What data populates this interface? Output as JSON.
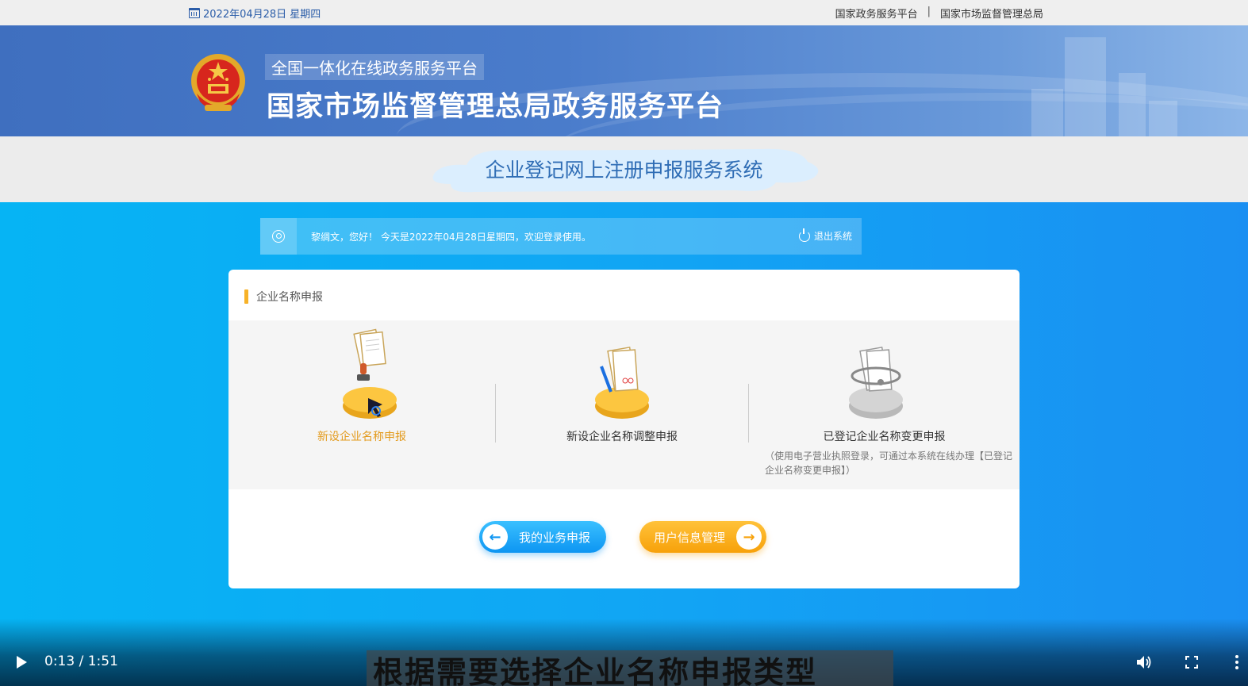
{
  "topbar": {
    "date": "2022年04月28日 星期四",
    "link1": "国家政务服务平台",
    "separator": "|",
    "link2": "国家市场监督管理总局"
  },
  "banner": {
    "subtitle": "全国一体化在线政务服务平台",
    "title": "国家市场监督管理总局政务服务平台"
  },
  "system": {
    "title": "企业登记网上注册申报服务系统"
  },
  "welcome": {
    "message": "黎绸文，您好！ 今天是2022年04月28日星期四，欢迎登录使用。",
    "logout": "退出系统"
  },
  "card": {
    "heading": "企业名称申报",
    "options": [
      {
        "label": "新设企业名称申报",
        "active": true
      },
      {
        "label": "新设企业名称调整申报",
        "active": false
      },
      {
        "label": "已登记企业名称变更申报",
        "note": "（使用电子营业执照登录，可通过本系统在线办理【已登记企业名称变更申报】）",
        "active": false
      }
    ],
    "buttons": {
      "my_business": "我的业务申报",
      "user_info": "用户信息管理"
    }
  },
  "video": {
    "time": "0:13 / 1:51",
    "caption": "根据需要选择企业名称申报类型"
  },
  "colors": {
    "accent_orange": "#f7b228",
    "brand_blue": "#2a5ca8",
    "main_blue": "#06b4f4"
  }
}
